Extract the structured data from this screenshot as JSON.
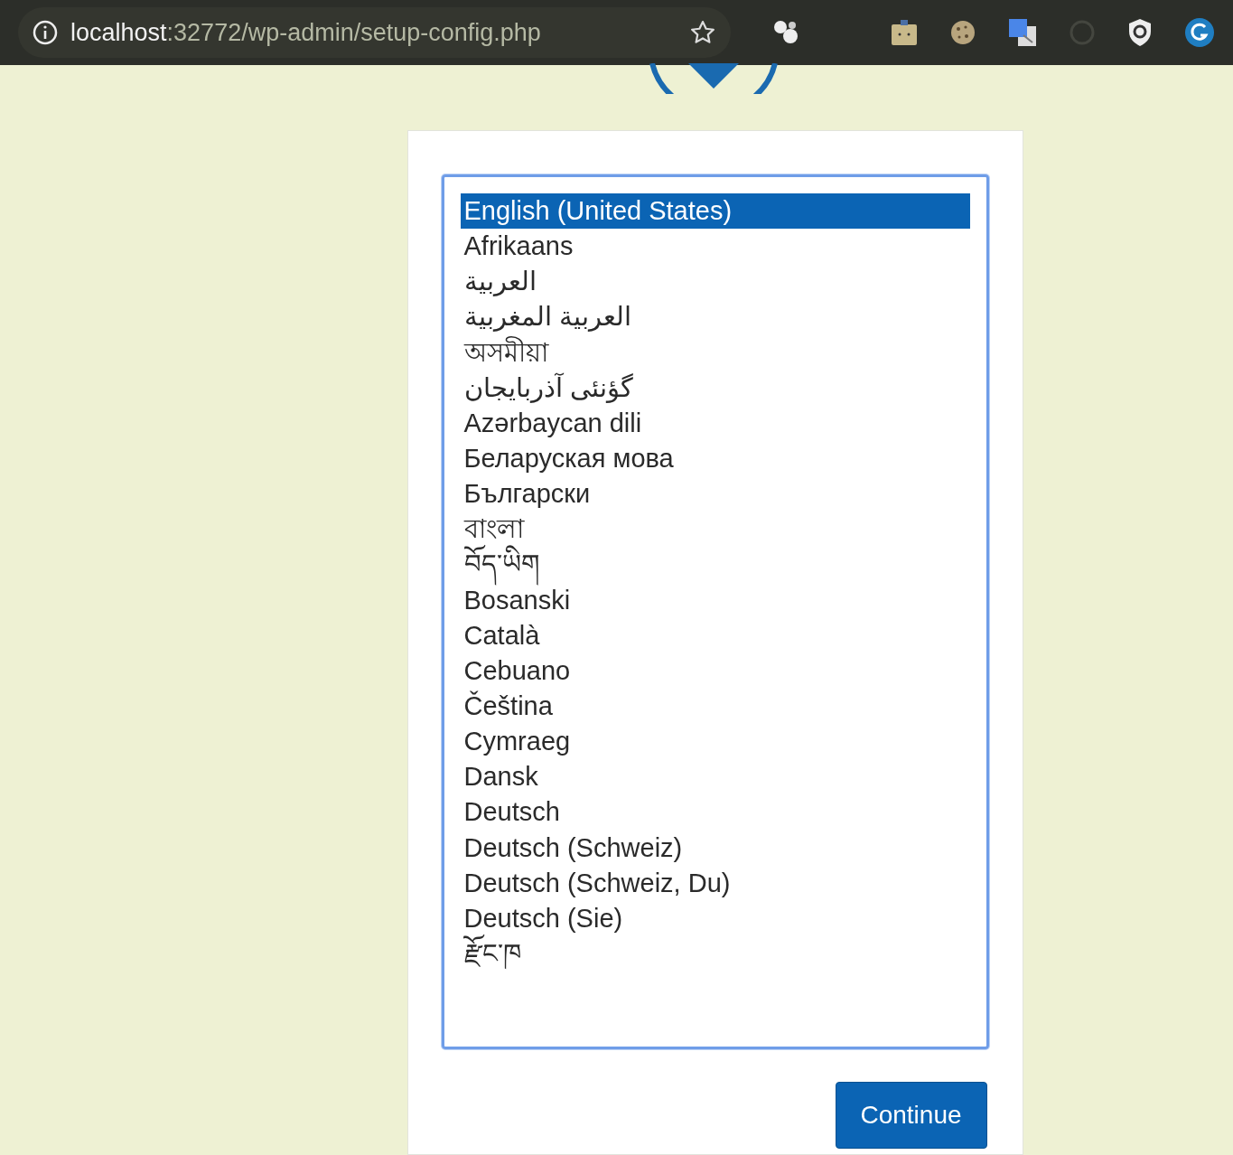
{
  "browser": {
    "url_host": "localhost",
    "url_path": ":32772/wp-admin/setup-config.php"
  },
  "language_list": [
    {
      "label": "English (United States)",
      "selected": true
    },
    {
      "label": "Afrikaans",
      "selected": false
    },
    {
      "label": "العربية",
      "selected": false
    },
    {
      "label": "العربية المغربية",
      "selected": false
    },
    {
      "label": "অসমীয়া",
      "selected": false
    },
    {
      "label": "گؤنئی آذربایجان",
      "selected": false
    },
    {
      "label": "Azərbaycan dili",
      "selected": false
    },
    {
      "label": "Беларуская мова",
      "selected": false
    },
    {
      "label": "Български",
      "selected": false
    },
    {
      "label": "বাংলা",
      "selected": false
    },
    {
      "label": "བོད་ཡིག",
      "selected": false
    },
    {
      "label": "Bosanski",
      "selected": false
    },
    {
      "label": "Català",
      "selected": false
    },
    {
      "label": "Cebuano",
      "selected": false
    },
    {
      "label": "Čeština",
      "selected": false
    },
    {
      "label": "Cymraeg",
      "selected": false
    },
    {
      "label": "Dansk",
      "selected": false
    },
    {
      "label": "Deutsch",
      "selected": false
    },
    {
      "label": "Deutsch (Schweiz)",
      "selected": false
    },
    {
      "label": "Deutsch (Schweiz, Du)",
      "selected": false
    },
    {
      "label": "Deutsch (Sie)",
      "selected": false
    },
    {
      "label": "རྫོང་ཁ",
      "selected": false
    }
  ],
  "continue_button": "Continue"
}
